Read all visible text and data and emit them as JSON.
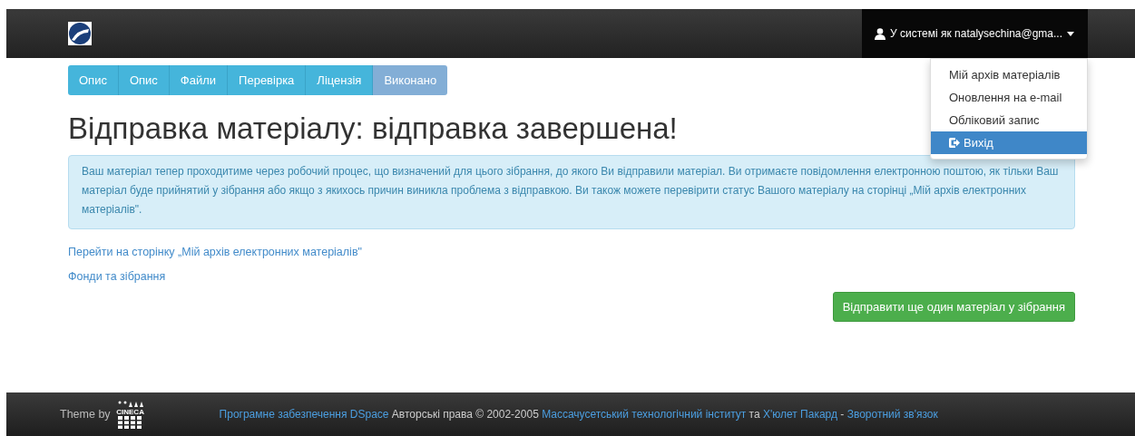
{
  "navbar": {
    "user_menu": {
      "label": "У системі як natalysechina@gma...",
      "expanded": true,
      "items": [
        {
          "label": "Мій архів матеріалів",
          "selected": false
        },
        {
          "label": "Оновлення на e-mail",
          "selected": false
        },
        {
          "label": "Обліковий запис",
          "selected": false
        },
        {
          "label": "Вихід",
          "selected": true,
          "kind": "logout"
        }
      ]
    }
  },
  "progress_steps": [
    {
      "label": "Опис",
      "selected": false
    },
    {
      "label": "Опис",
      "selected": false
    },
    {
      "label": "Файли",
      "selected": false
    },
    {
      "label": "Перевірка",
      "selected": false
    },
    {
      "label": "Ліцензія",
      "selected": false
    },
    {
      "label": "Виконано",
      "selected": true
    }
  ],
  "heading": "Відправка матеріалу: відправка завершена!",
  "info_message": "Ваш матеріал тепер проходитиме через робочий процес, що визначений для цього зібрання, до якого Ви відправили матеріал. Ви отримаєте повідомлення електронною поштою, як тільки Ваш матеріал буде прийнятий у зібрання або якщо з якихось причин виникла проблема з відправкою. Ви також можете перевірити статус Вашого матеріалу на сторінці „Мій архів електронних матеріалів\".",
  "links": [
    "Перейти на сторінку „Мій архів електронних матеріалів\"",
    "Фонди та зібрання"
  ],
  "submit_another_button": "Відправити ще один матеріал у зібрання",
  "footer": {
    "theme_by": "Theme by",
    "theme_logo": "CINECA",
    "parts": [
      {
        "kind": "link",
        "text": "Програмне забезпечення DSpace"
      },
      {
        "kind": "text",
        "text": "Авторські права © 2002-2005"
      },
      {
        "kind": "link",
        "text": "Массачусетський технологічний інститут"
      },
      {
        "kind": "text",
        "text": "та"
      },
      {
        "kind": "link",
        "text": "Х'юлет Пакард"
      },
      {
        "kind": "text",
        "text": "-"
      },
      {
        "kind": "link",
        "text": "Зворотний зв'язок"
      }
    ]
  }
}
